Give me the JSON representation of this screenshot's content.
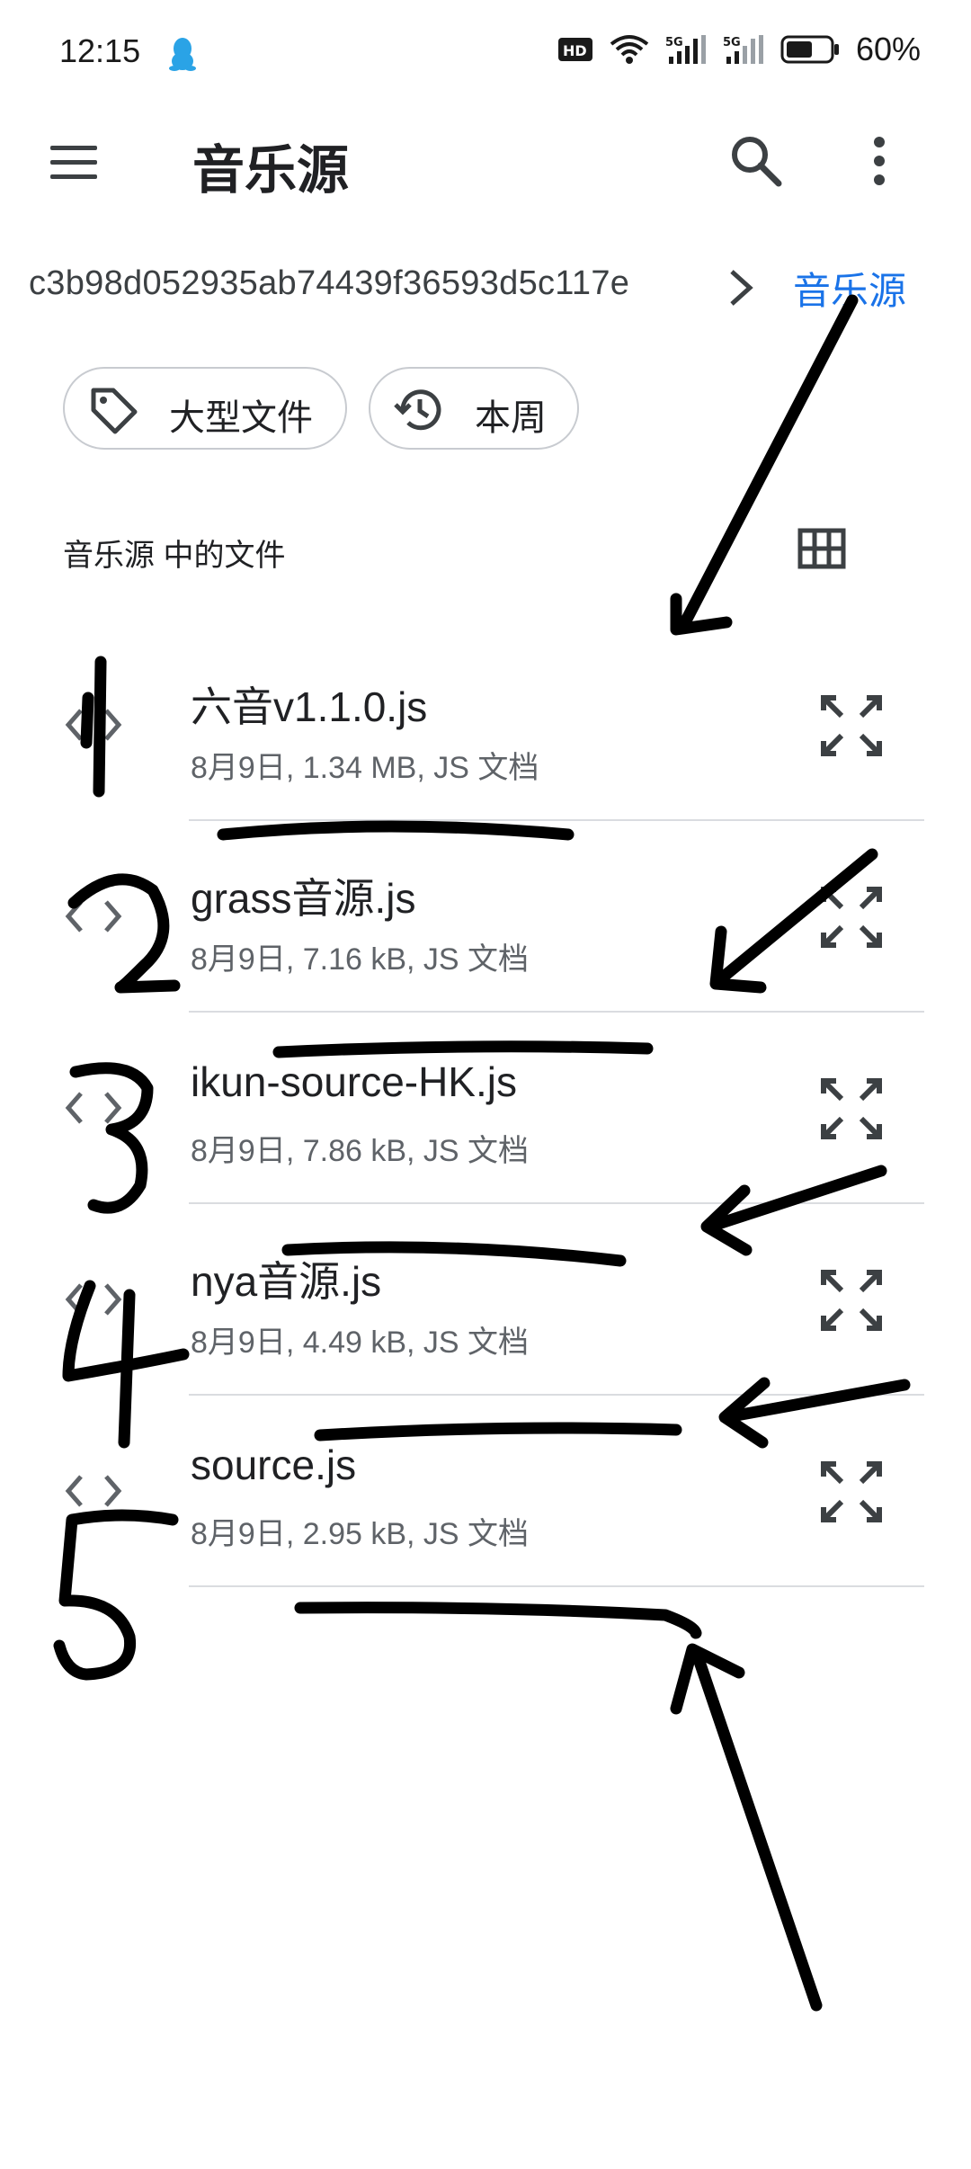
{
  "status_bar": {
    "time": "12:15",
    "app_icon": "qq-penguin-icon",
    "network_icons": [
      "hd-icon",
      "wifi-icon",
      "5g-signal-icon",
      "5g-signal-icon"
    ],
    "battery_percent": "60%",
    "battery_level": 0.6
  },
  "app_bar": {
    "title": "音乐源",
    "menu_icon": "menu-icon",
    "search_icon": "search-icon",
    "overflow_icon": "more-vert-icon"
  },
  "breadcrumb": {
    "root": "c3b98d052935ab74439f36593d5c117e",
    "current": "音乐源",
    "accent_color": "#1a73e8"
  },
  "chips": [
    {
      "label": "大型文件",
      "icon": "tag-icon"
    },
    {
      "label": "本周",
      "icon": "history-icon"
    }
  ],
  "section": {
    "title": "音乐源 中的文件",
    "view_icon": "grid-view-icon"
  },
  "files": [
    {
      "name": "六音v1.1.0.js",
      "meta": "8月9日, 1.34 MB, JS 文档"
    },
    {
      "name": "grass音源.js",
      "meta": "8月9日, 7.16 kB, JS 文档"
    },
    {
      "name": "ikun-source-HK.js",
      "meta": "8月9日, 7.86 kB, JS 文档"
    },
    {
      "name": "nya音源.js",
      "meta": "8月9日, 4.49 kB, JS 文档"
    },
    {
      "name": "source.js",
      "meta": "8月9日, 2.95 kB, JS 文档"
    }
  ],
  "annotations": {
    "ink_color": "#000000",
    "numbers": [
      "1",
      "2",
      "3",
      "4",
      "5"
    ]
  }
}
